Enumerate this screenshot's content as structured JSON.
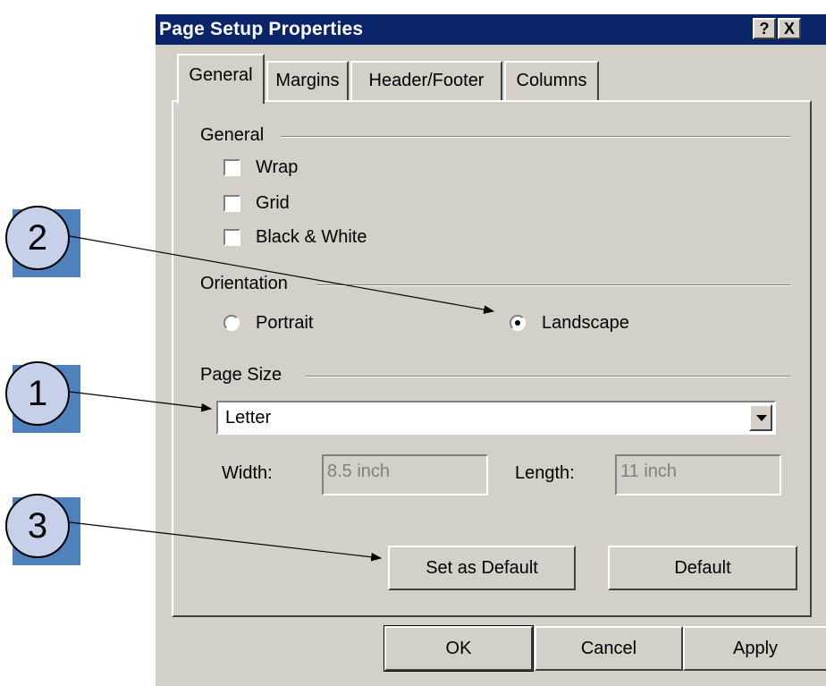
{
  "dialog": {
    "title": "Page Setup Properties",
    "help_btn": "?",
    "close_btn": "X"
  },
  "tabs": [
    {
      "label": "General",
      "active": true
    },
    {
      "label": "Margins",
      "active": false
    },
    {
      "label": "Header/Footer",
      "active": false
    },
    {
      "label": "Columns",
      "active": false
    }
  ],
  "general_group": {
    "label": "General",
    "wrap": {
      "label": "Wrap",
      "checked": false
    },
    "grid": {
      "label": "Grid",
      "checked": false
    },
    "bw": {
      "label": "Black & White",
      "checked": false
    }
  },
  "orientation": {
    "label": "Orientation",
    "portrait": {
      "label": "Portrait",
      "selected": false
    },
    "landscape": {
      "label": "Landscape",
      "selected": true
    }
  },
  "page_size": {
    "label": "Page Size",
    "selected": "Letter",
    "width_label": "Width:",
    "width_value": "8.5 inch",
    "length_label": "Length:",
    "length_value": "11 inch"
  },
  "buttons": {
    "set_default": "Set as Default",
    "default": "Default",
    "ok": "OK",
    "cancel": "Cancel",
    "apply": "Apply"
  },
  "callouts": {
    "c1": "1",
    "c2": "2",
    "c3": "3"
  },
  "colors": {
    "titlebar": "#0a246a",
    "dialog_bg": "#d4d0c8",
    "callout_square": "#4f81bd",
    "callout_circle": "#c6d0e8"
  }
}
